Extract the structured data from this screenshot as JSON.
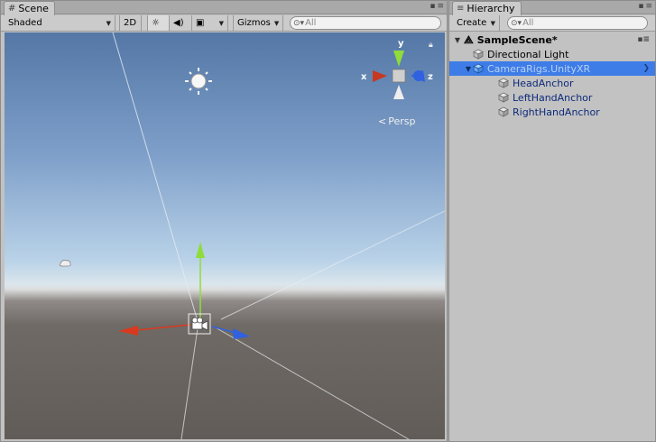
{
  "scene": {
    "tab_label": "Scene",
    "shading_mode": "Shaded",
    "toggle_2d": "2D",
    "gizmos_label": "Gizmos",
    "search_placeholder": "All",
    "projection_label": "Persp",
    "axes": {
      "x": "x",
      "y": "y",
      "z": "z"
    }
  },
  "hierarchy": {
    "tab_label": "Hierarchy",
    "create_label": "Create",
    "search_placeholder": "All",
    "scene_name": "SampleScene*",
    "items": [
      {
        "label": "Directional Light",
        "depth": 1,
        "selected": false,
        "expandable": false
      },
      {
        "label": "CameraRigs.UnityXR",
        "depth": 1,
        "selected": true,
        "expandable": true
      },
      {
        "label": "HeadAnchor",
        "depth": 2,
        "selected": false,
        "expandable": false
      },
      {
        "label": "LeftHandAnchor",
        "depth": 2,
        "selected": false,
        "expandable": false
      },
      {
        "label": "RightHandAnchor",
        "depth": 2,
        "selected": false,
        "expandable": false
      }
    ]
  },
  "colors": {
    "selection": "#3e7de7",
    "axis_x": "#d9391e",
    "axis_y": "#8fdc3a",
    "axis_z": "#2f61e0"
  }
}
